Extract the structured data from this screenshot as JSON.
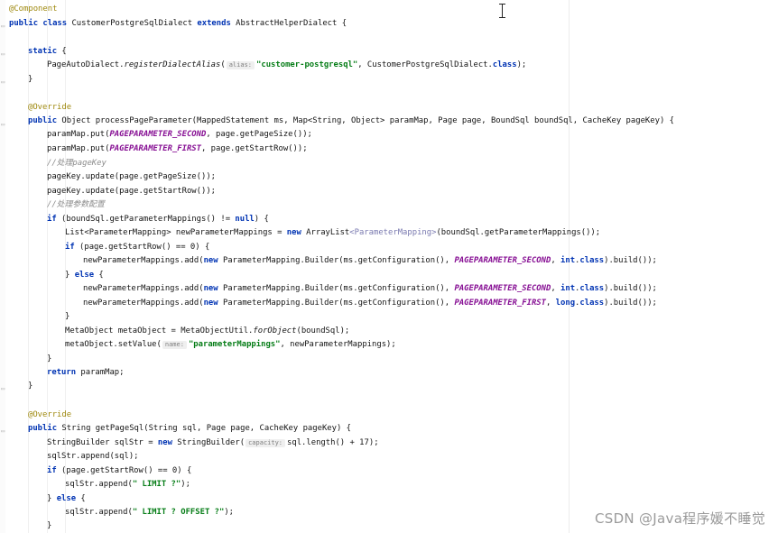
{
  "editor": {
    "language": "Java",
    "colors": {
      "keyword": "#0033b3",
      "annotation": "#9e880d",
      "string": "#067d17",
      "constant": "#871094",
      "comment": "#8c8c8c",
      "generic": "#7a7ab0"
    },
    "hints": {
      "alias": "alias:",
      "name": "name:",
      "capacity": "capacity:"
    },
    "strings": {
      "dialect_alias": "\"customer-postgresql\"",
      "param_mappings": "\"parameterMappings\"",
      "limit": "\" LIMIT ?\"",
      "limit_offset": "\" LIMIT ? OFFSET ?\""
    },
    "constants": {
      "second": "PAGEPARAMETER_SECOND",
      "first": "PAGEPARAMETER_FIRST"
    },
    "comments": {
      "page_key": "//处理pageKey",
      "param_config": "//处理参数配置"
    }
  },
  "watermark": "CSDN @Java程序媛不睡觉"
}
